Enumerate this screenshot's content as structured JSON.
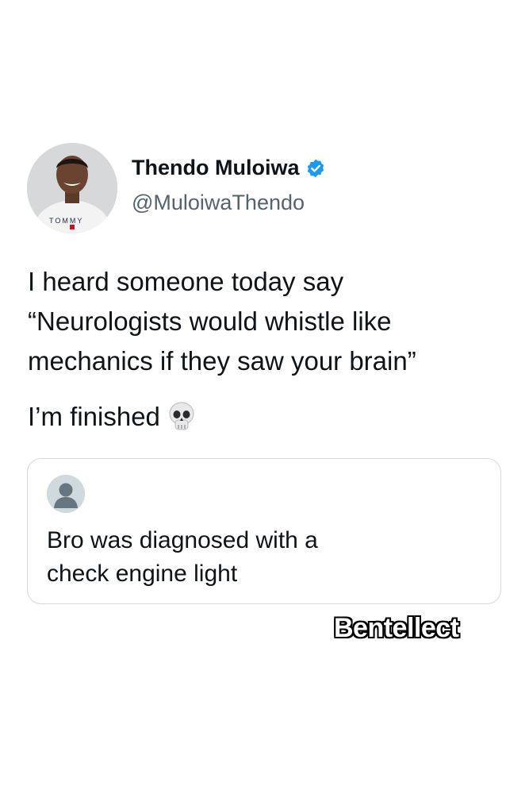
{
  "tweet": {
    "author": {
      "name": "Thendo Muloiwa",
      "handle": "@MuloiwaThendo",
      "shirt_brand": "TOMMY",
      "verified": true,
      "verified_color": "#1d9bf0",
      "avatar_icon": "profile-photo"
    },
    "lines": [
      "I heard someone today say",
      "“Neurologists would whistle like",
      "mechanics if they saw your brain”"
    ],
    "closing": "I’m finished",
    "closing_icon": "skull-icon"
  },
  "reply": {
    "avatar_icon": "default-user-avatar",
    "lines": [
      "Bro was diagnosed with a",
      "check engine light"
    ]
  },
  "watermark": "Bentellect",
  "colors": {
    "text": "#0f1419",
    "secondary": "#536471",
    "card_border": "#d5d9dc",
    "background": "#ffffff"
  }
}
